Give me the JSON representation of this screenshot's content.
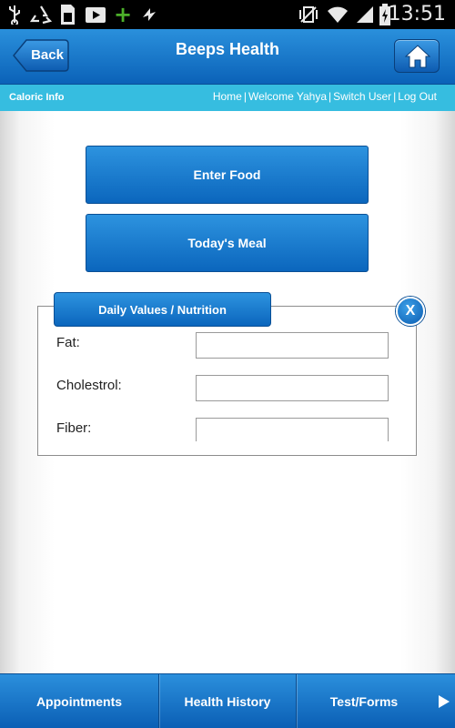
{
  "status_bar": {
    "time": "13:51",
    "left_icons": [
      "usb-icon",
      "recycle-icon",
      "sd-card-icon",
      "play-store-icon",
      "plus-icon",
      "sync-icon"
    ],
    "right_icons": [
      "vibrate-icon",
      "wifi-icon",
      "signal-icon",
      "battery-icon"
    ]
  },
  "header": {
    "back_label": "Back",
    "title": "Beeps Health",
    "home_icon": "home-icon",
    "color": "#1a7ccd"
  },
  "subheader": {
    "title": "Caloric Info",
    "links": [
      "Home",
      "Welcome Yahya",
      "Switch User",
      "Log Out"
    ],
    "separator": "|",
    "color": "#36bde0"
  },
  "main": {
    "enter_food_label": "Enter Food",
    "todays_meal_label": "Today's Meal",
    "panel": {
      "title": "Daily Values / Nutrition",
      "close_label": "X",
      "fields": [
        {
          "label": "Fat:",
          "value": ""
        },
        {
          "label": "Cholestrol:",
          "value": ""
        },
        {
          "label": "Fiber:",
          "value": ""
        }
      ]
    }
  },
  "bottom_nav": {
    "items": [
      "Appointments",
      "Health History",
      "Test/Forms"
    ],
    "more_icon": "right-arrow-icon"
  }
}
